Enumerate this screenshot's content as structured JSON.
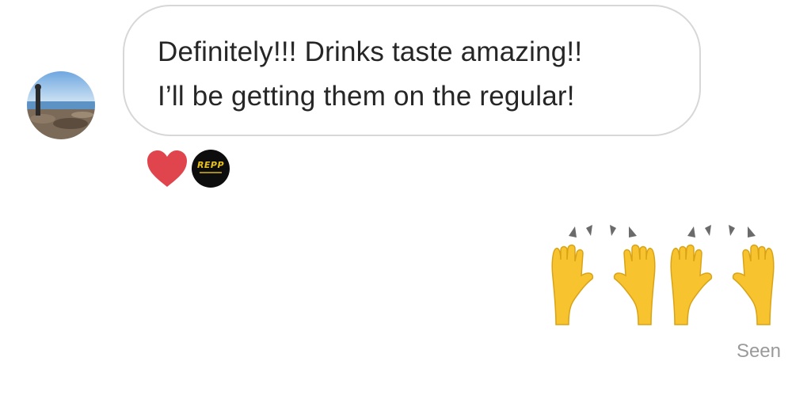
{
  "conversation": {
    "incoming_message": {
      "lines": [
        "Definitely!!! Drinks taste amazing!!",
        "I’ll be getting them on the regular!"
      ]
    },
    "reactions": [
      {
        "type": "heart",
        "icon": "heart-icon",
        "color": "#e0454d"
      },
      {
        "type": "reactor-avatar",
        "logo_text": "REPP"
      }
    ],
    "outgoing_message": {
      "emoji": "🙌🙌",
      "emoji_name": "raising-hands-icon"
    },
    "status": {
      "seen_label": "Seen"
    }
  },
  "colors": {
    "bubble_border": "#d7d7d7",
    "text": "#262626",
    "status_text": "#9a9a9a",
    "emoji_yellow": "#f7c32e"
  }
}
